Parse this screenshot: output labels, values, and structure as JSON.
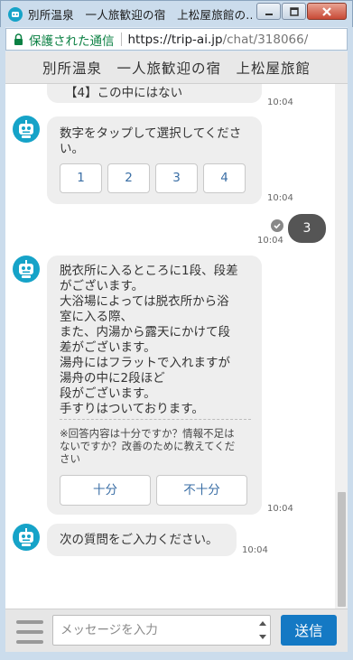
{
  "window": {
    "title": "別所温泉　一人旅歓迎の宿　上松屋旅館の..."
  },
  "address_bar": {
    "secure_label": "保護された通信",
    "url_host": "https://trip-ai.jp",
    "url_path": "/chat/318066/"
  },
  "chat_header": {
    "title": "別所温泉　一人旅歓迎の宿　上松屋旅館"
  },
  "messages": {
    "m1": {
      "text": "【4】この中にはない",
      "time": "10:04"
    },
    "m2": {
      "text": "数字をタップして選択してください。",
      "options": [
        "1",
        "2",
        "3",
        "4"
      ],
      "time": "10:04"
    },
    "user_reply": {
      "text": "3",
      "time": "10:04"
    },
    "m3": {
      "lines": [
        "脱衣所に入るところに1段、段差",
        "がございます。",
        "大浴場によっては脱衣所から浴",
        "室に入る際、",
        "また、内湯から露天にかけて段",
        "差がございます。",
        "湯舟にはフラットで入れますが",
        "湯舟の中に2段ほど",
        "段がございます。",
        "手すりはついております。"
      ],
      "feedback_lines": [
        "※回答内容は十分ですか？情報不足は",
        "ないですか？改善のために教えてくだ",
        "さい"
      ],
      "btn_enough": "十分",
      "btn_not_enough": "不十分",
      "time": "10:04"
    },
    "m4": {
      "text": "次の質問をご入力ください。",
      "time": "10:04"
    }
  },
  "input_bar": {
    "placeholder": "メッセージを入力",
    "send_label": "送信"
  },
  "colors": {
    "avatar": "#16a3c8",
    "send_button": "#1479c4",
    "user_bubble": "#555555",
    "secure_green": "#0b8043"
  }
}
